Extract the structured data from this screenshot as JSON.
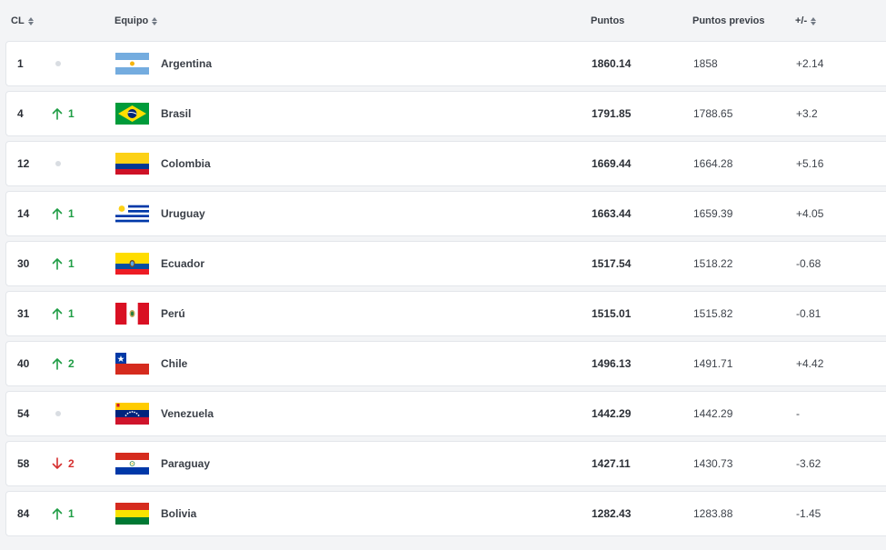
{
  "header": {
    "rank": "CL",
    "team": "Equipo",
    "points": "Puntos",
    "previous": "Puntos previos",
    "diff": "+/-"
  },
  "rows": [
    {
      "rank": "1",
      "move": "",
      "dir": "none",
      "team": "Argentina",
      "points": "1860.14",
      "previous": "1858",
      "diff": "+2.14",
      "flag": "argentina"
    },
    {
      "rank": "4",
      "move": "1",
      "dir": "up",
      "team": "Brasil",
      "points": "1791.85",
      "previous": "1788.65",
      "diff": "+3.2",
      "flag": "brasil"
    },
    {
      "rank": "12",
      "move": "",
      "dir": "none",
      "team": "Colombia",
      "points": "1669.44",
      "previous": "1664.28",
      "diff": "+5.16",
      "flag": "colombia"
    },
    {
      "rank": "14",
      "move": "1",
      "dir": "up",
      "team": "Uruguay",
      "points": "1663.44",
      "previous": "1659.39",
      "diff": "+4.05",
      "flag": "uruguay"
    },
    {
      "rank": "30",
      "move": "1",
      "dir": "up",
      "team": "Ecuador",
      "points": "1517.54",
      "previous": "1518.22",
      "diff": "-0.68",
      "flag": "ecuador"
    },
    {
      "rank": "31",
      "move": "1",
      "dir": "up",
      "team": "Perú",
      "points": "1515.01",
      "previous": "1515.82",
      "diff": "-0.81",
      "flag": "peru"
    },
    {
      "rank": "40",
      "move": "2",
      "dir": "up",
      "team": "Chile",
      "points": "1496.13",
      "previous": "1491.71",
      "diff": "+4.42",
      "flag": "chile"
    },
    {
      "rank": "54",
      "move": "",
      "dir": "none",
      "team": "Venezuela",
      "points": "1442.29",
      "previous": "1442.29",
      "diff": "-",
      "flag": "venezuela"
    },
    {
      "rank": "58",
      "move": "2",
      "dir": "down",
      "team": "Paraguay",
      "points": "1427.11",
      "previous": "1430.73",
      "diff": "-3.62",
      "flag": "paraguay"
    },
    {
      "rank": "84",
      "move": "1",
      "dir": "up",
      "team": "Bolivia",
      "points": "1282.43",
      "previous": "1283.88",
      "diff": "-1.45",
      "flag": "bolivia"
    }
  ],
  "colors": {
    "up": "#1f9d45",
    "down": "#d63030",
    "neutral": "#d9dde2"
  }
}
